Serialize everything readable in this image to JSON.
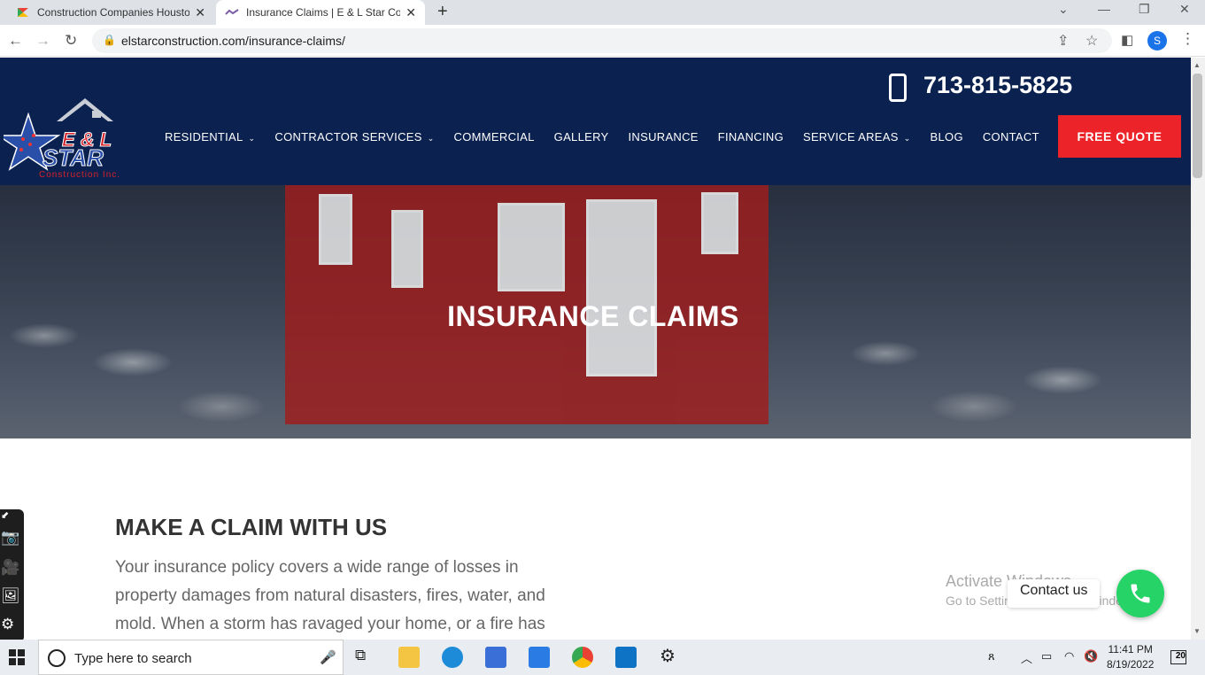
{
  "browser": {
    "tabs": [
      {
        "title": "Construction Companies Housto"
      },
      {
        "title": "Insurance Claims | E & L Star Con"
      }
    ],
    "url": "elstarconstruction.com/insurance-claims/",
    "profile_initial": "S"
  },
  "site": {
    "logo": {
      "line1": "E & L",
      "line2": "STAR",
      "line3": "Construction Inc."
    },
    "phone": "713-815-5825",
    "nav": [
      {
        "label": "RESIDENTIAL",
        "dropdown": true
      },
      {
        "label": "CONTRACTOR SERVICES",
        "dropdown": true
      },
      {
        "label": "COMMERCIAL",
        "dropdown": false
      },
      {
        "label": "GALLERY",
        "dropdown": false
      },
      {
        "label": "INSURANCE",
        "dropdown": false
      },
      {
        "label": "FINANCING",
        "dropdown": false
      },
      {
        "label": "SERVICE AREAS",
        "dropdown": true
      },
      {
        "label": "BLOG",
        "dropdown": false
      },
      {
        "label": "CONTACT",
        "dropdown": false
      }
    ],
    "cta": "FREE QUOTE",
    "hero_title": "INSURANCE CLAIMS",
    "section_heading": "MAKE A CLAIM WITH US",
    "paragraph": "Your insurance policy covers a wide range of losses in property damages from natural disasters, fires, water, and mold. When a storm has ravaged your home, or a fire has",
    "contact_widget": "Contact us",
    "colors": {
      "header": "#0b2150",
      "cta": "#ec2329",
      "contact": "#25d366"
    }
  },
  "overlay": {
    "activate_title": "Activate Windows",
    "activate_sub": "Go to Settings to activate Windows."
  },
  "taskbar": {
    "search_placeholder": "Type here to search",
    "time": "11:41 PM",
    "date": "8/19/2022",
    "notifications": "20"
  }
}
